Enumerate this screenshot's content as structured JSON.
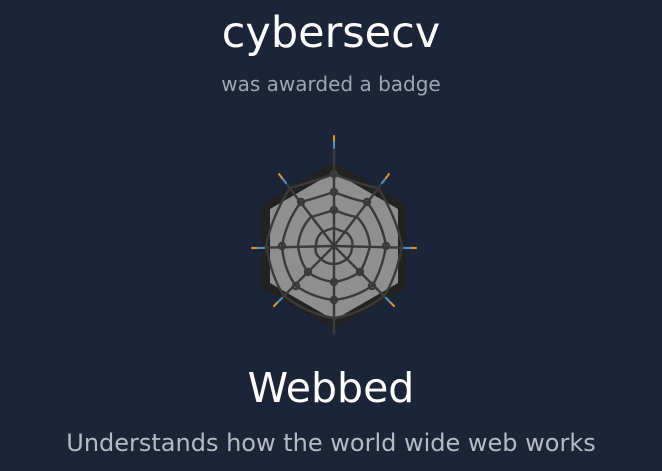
{
  "profile": {
    "username": "cybersecv",
    "award_text": "was awarded a badge"
  },
  "badge": {
    "icon": "spider-web-icon",
    "name": "Webbed",
    "description": "Understands how the world wide web works"
  },
  "colors": {
    "background": "#1c2538",
    "hex_outer": "#222222",
    "hex_inner": "#8f8f8f",
    "web_strand": "#3a3a3a",
    "strand_tip_blue": "#4a90c2",
    "strand_tip_orange": "#e0902a"
  }
}
